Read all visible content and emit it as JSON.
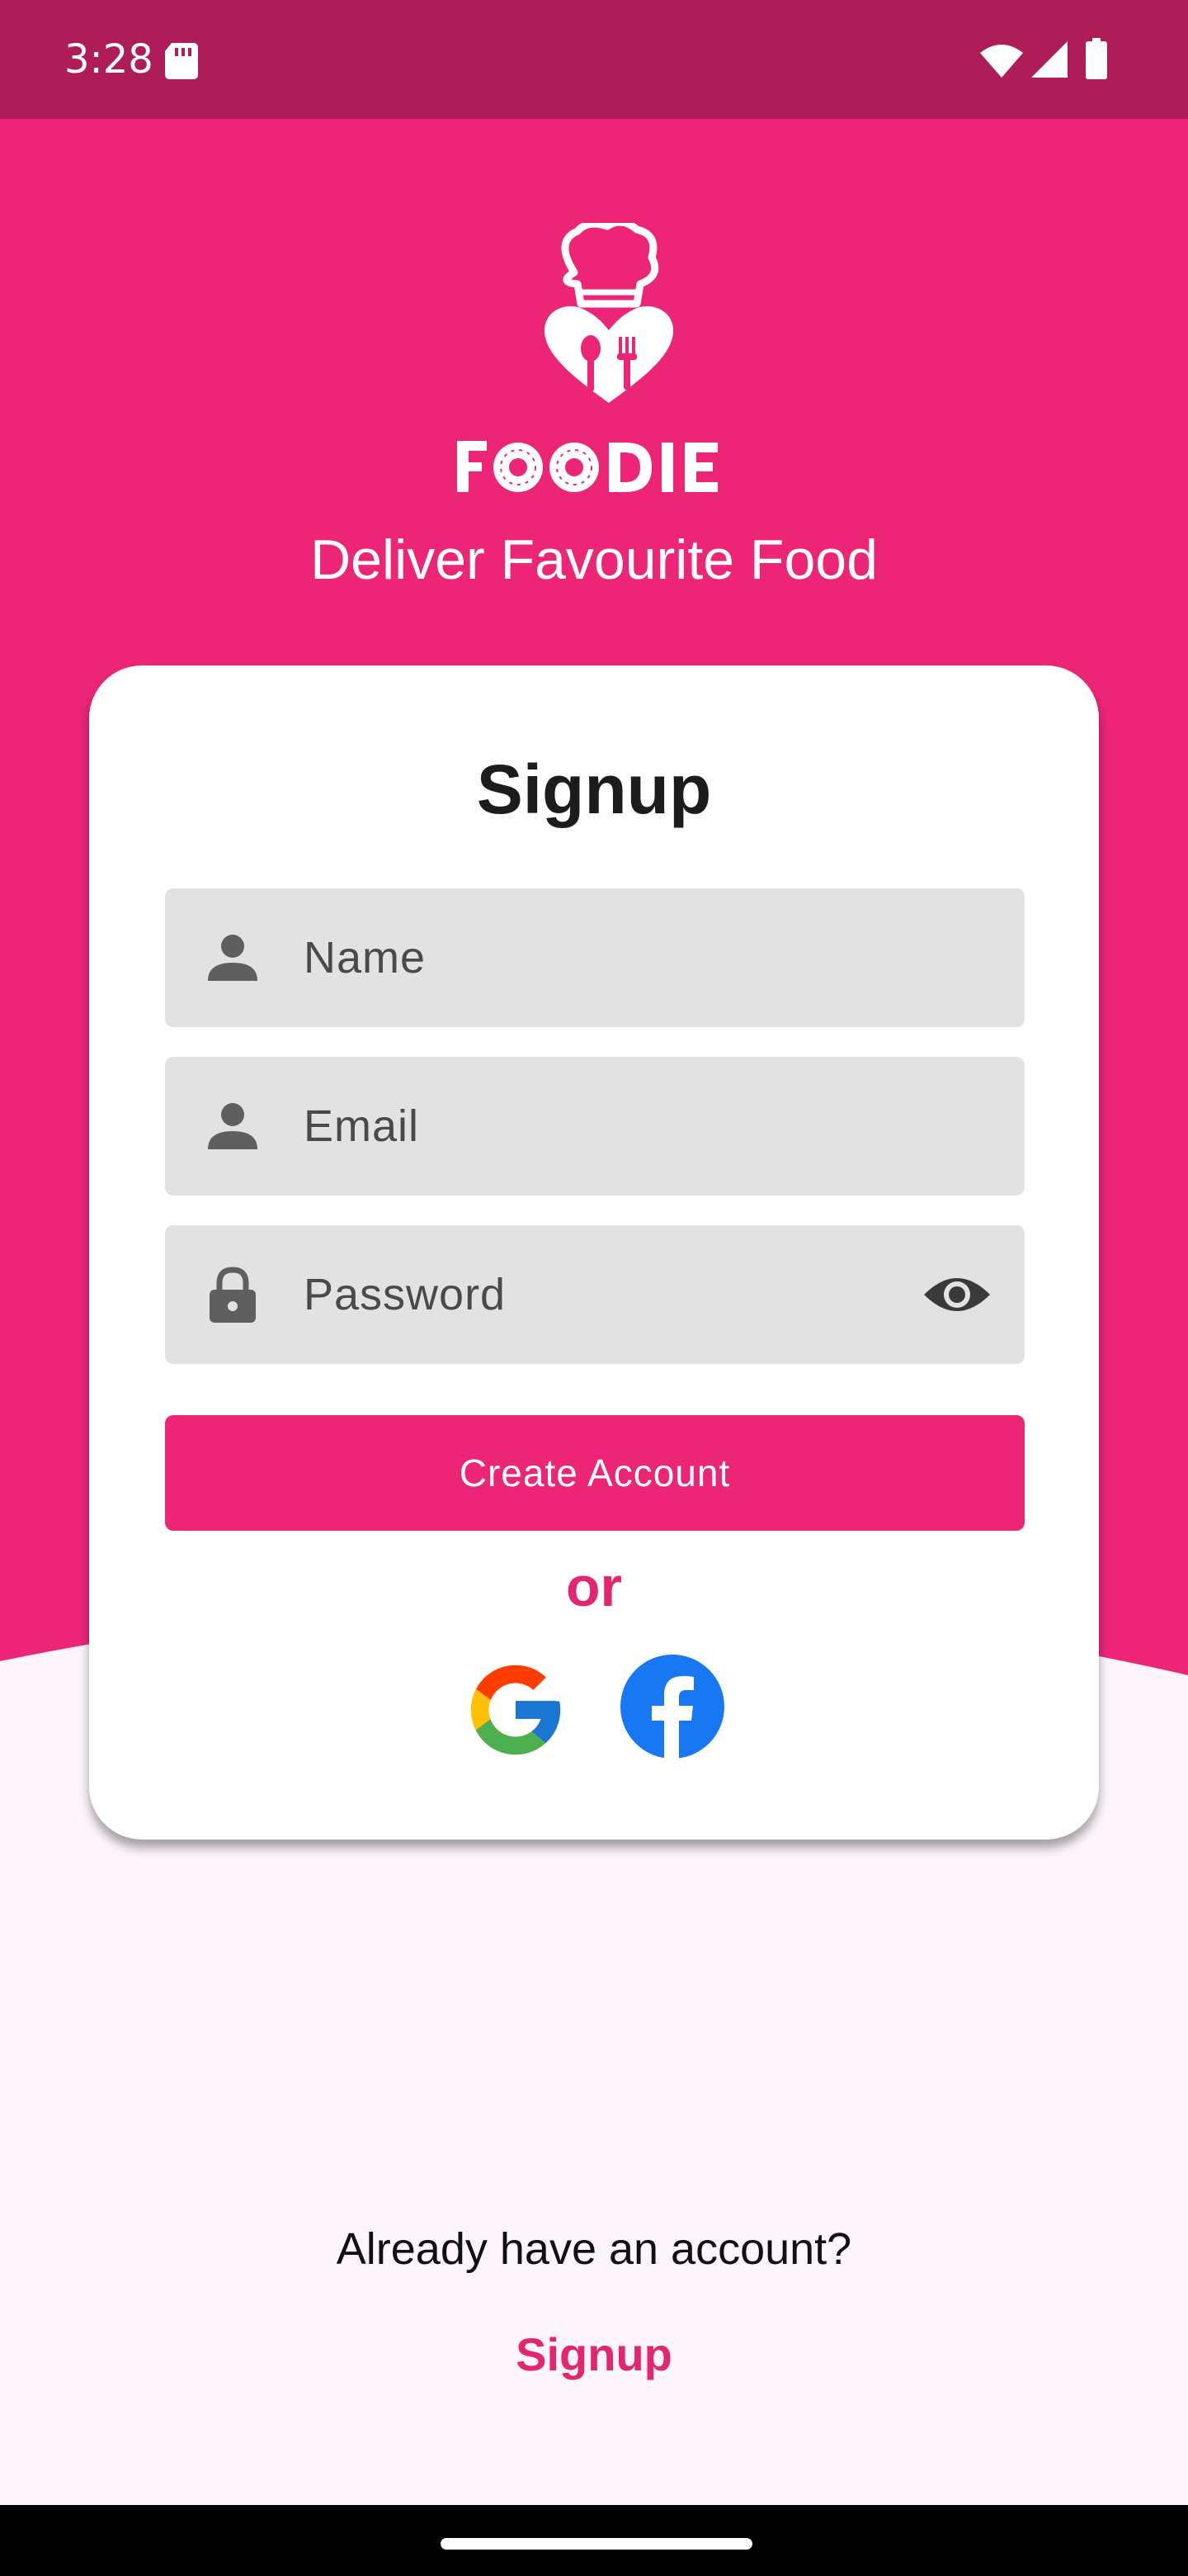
{
  "status_bar": {
    "time": "3:28",
    "icons": [
      "sd-card-icon",
      "wifi-icon",
      "signal-icon",
      "battery-icon"
    ]
  },
  "brand": {
    "logo_text": "FOODIE",
    "tagline": "Deliver Favourite Food"
  },
  "signup_card": {
    "title": "Signup",
    "name_field": {
      "placeholder": "Name",
      "value": "",
      "icon": "person-icon"
    },
    "email_field": {
      "placeholder": "Email",
      "value": "",
      "icon": "person-icon"
    },
    "password_field": {
      "placeholder": "Password",
      "value": "",
      "icon": "lock-icon",
      "toggle_icon": "eye-icon"
    },
    "create_button": "Create Account",
    "divider_text": "or",
    "social_buttons": [
      "google-icon",
      "facebook-icon"
    ]
  },
  "footer": {
    "prompt": "Already have an account?",
    "link": "Signup"
  },
  "colors": {
    "primary": "#EC2577",
    "status_bar": "#AE1D57",
    "accent_text": "#E2266F",
    "background": "#FDF5FC",
    "field_background": "#E2E2E2",
    "facebook_blue": "#1877F2"
  }
}
